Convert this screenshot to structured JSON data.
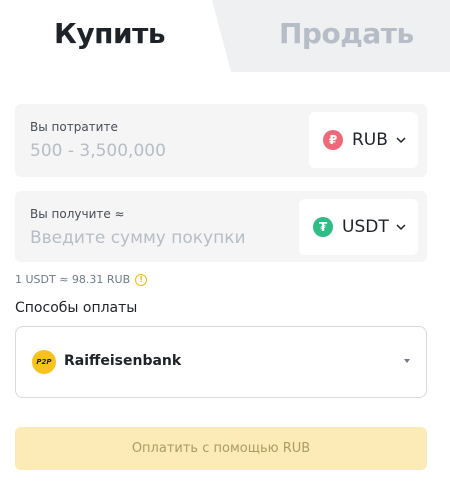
{
  "tabs": {
    "buy": "Купить",
    "sell": "Продать"
  },
  "spend": {
    "label": "Вы потратите",
    "placeholder": "500 - 3,500,000",
    "currency_symbol": "₽",
    "currency": "RUB"
  },
  "receive": {
    "label": "Вы получите ≈",
    "placeholder": "Введите сумму покупки",
    "currency_symbol": "₮",
    "currency": "USDT"
  },
  "rate": {
    "text": "1 USDT ≈ 98.31 RUB",
    "info_icon": "info-icon"
  },
  "payment": {
    "title": "Способы оплаты",
    "badge": "P2P",
    "selected": "Raiffeisenbank"
  },
  "action": {
    "label": "Оплатить с помощью RUB"
  },
  "colors": {
    "accent": "#f0b90b",
    "button_disabled_bg": "#fcebb6",
    "rub_coin": "#ef6a78",
    "usdt_coin": "#2ebd85"
  }
}
